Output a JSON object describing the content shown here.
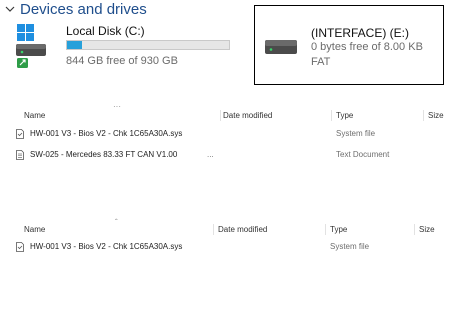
{
  "section": {
    "title": "Devices and drives"
  },
  "drives": [
    {
      "name": "Local Disk (C:)",
      "free_text": "844 GB free of 930 GB",
      "used_fraction": 0.09
    },
    {
      "name": "(INTERFACE) (E:)",
      "free_text": "0 bytes free of 8.00 KB",
      "filesystem": "FAT"
    }
  ],
  "list1": {
    "headers": {
      "name": "Name",
      "date": "Date modified",
      "type": "Type",
      "size": "Size"
    },
    "rows": [
      {
        "name": "HW-001 V3 - Bios V2 - Chk 1C65A30A.sys",
        "date": "",
        "type": "System file"
      },
      {
        "name": "SW-025 - Mercedes 83.33 FT CAN V1.00",
        "date": "...",
        "type": "Text Document"
      }
    ]
  },
  "list2": {
    "headers": {
      "name": "Name",
      "date": "Date modified",
      "type": "Type",
      "size": "Size"
    },
    "rows": [
      {
        "name": "HW-001 V3 - Bios V2 - Chk 1C65A30A.sys",
        "date": "",
        "type": "System file"
      }
    ]
  }
}
